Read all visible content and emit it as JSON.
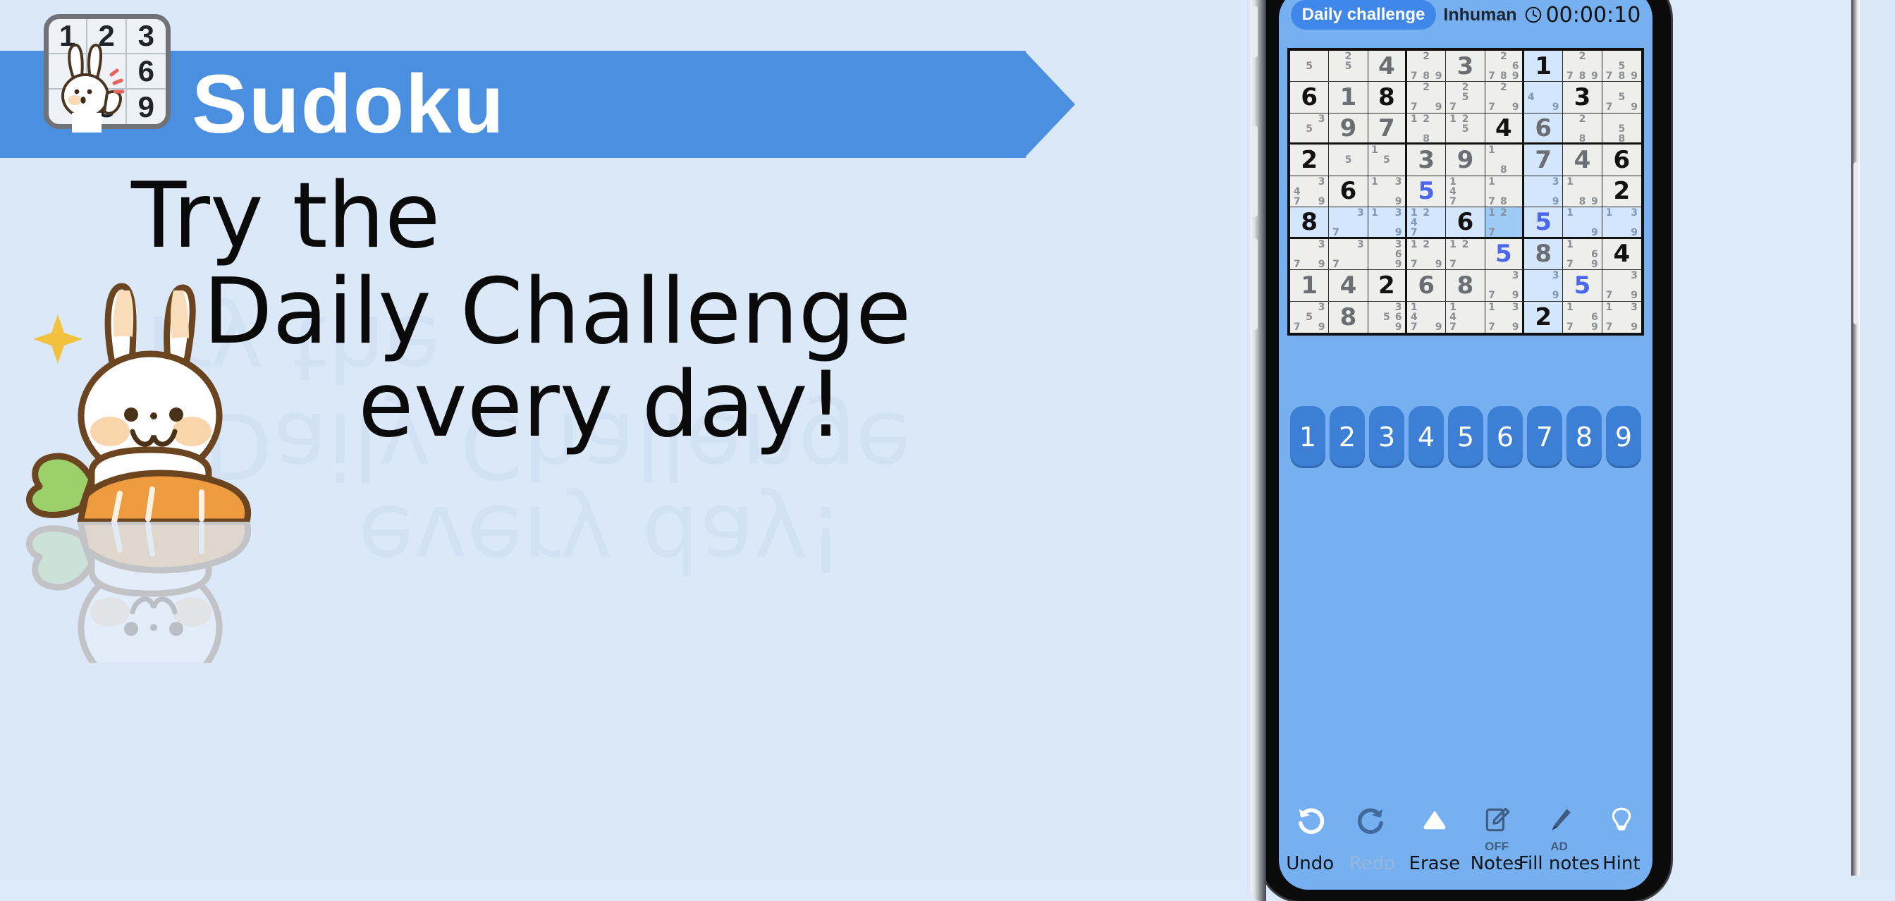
{
  "promo": {
    "banner_title": "Sudoku",
    "headline_lines": [
      "Try the",
      "Daily Challenge",
      "every day!"
    ],
    "logo_tile_digits": [
      "1",
      "2",
      "3",
      "",
      "",
      "6",
      "",
      "8",
      "9"
    ],
    "accent_blue": "#4a8fe0",
    "background": "#dbe8f8"
  },
  "phone": {
    "top_bar": {
      "daily_badge": "Daily challenge",
      "difficulty": "Inhuman",
      "clock_icon": "clock-icon",
      "timer": "00:00:10"
    },
    "numpad": [
      "1",
      "2",
      "3",
      "4",
      "5",
      "6",
      "7",
      "8",
      "9"
    ],
    "toolbar": [
      {
        "icon": "undo-icon",
        "label": "Undo",
        "badge": "",
        "disabled": false
      },
      {
        "icon": "redo-icon",
        "label": "Redo",
        "badge": "",
        "disabled": true
      },
      {
        "icon": "eraser-icon",
        "label": "Erase",
        "badge": "",
        "disabled": false
      },
      {
        "icon": "notes-icon",
        "label": "Notes",
        "badge": "OFF",
        "disabled": false
      },
      {
        "icon": "fill-notes-icon",
        "label": "Fill notes",
        "badge": "AD",
        "disabled": false
      },
      {
        "icon": "hint-bulb-icon",
        "label": "Hint",
        "badge": "",
        "disabled": false
      }
    ],
    "board": {
      "selected_cell": [
        5,
        5
      ],
      "highlighted_rows": [
        5
      ],
      "highlighted_cols": [
        6
      ],
      "colors": {
        "given": "#111111",
        "solved": "#6b6f73",
        "user_entry": "#4b67f0",
        "note": "#8b8f93",
        "cell_bg": "#eeeeec",
        "highlight_bg": "#d3e6fb",
        "selected_bg": "#9ecbf5"
      },
      "cells": [
        [
          {
            "v": "",
            "k": "",
            "n": [
              0,
              0,
              0,
              0,
              5,
              0,
              0,
              0,
              0
            ]
          },
          {
            "v": "",
            "k": "",
            "n": [
              0,
              2,
              0,
              0,
              5,
              0,
              0,
              0,
              0
            ]
          },
          {
            "v": "4",
            "k": "solved",
            "n": []
          },
          {
            "v": "",
            "k": "",
            "n": [
              0,
              2,
              0,
              0,
              0,
              0,
              7,
              8,
              9
            ]
          },
          {
            "v": "3",
            "k": "solved",
            "n": []
          },
          {
            "v": "",
            "k": "",
            "n": [
              0,
              2,
              0,
              0,
              0,
              6,
              7,
              8,
              9
            ]
          },
          {
            "v": "1",
            "k": "given",
            "n": []
          },
          {
            "v": "",
            "k": "",
            "n": [
              0,
              2,
              0,
              0,
              0,
              0,
              7,
              8,
              9
            ]
          },
          {
            "v": "",
            "k": "",
            "n": [
              0,
              0,
              0,
              0,
              5,
              0,
              7,
              8,
              9
            ]
          }
        ],
        [
          {
            "v": "6",
            "k": "given",
            "n": []
          },
          {
            "v": "1",
            "k": "solved",
            "n": []
          },
          {
            "v": "8",
            "k": "given",
            "n": []
          },
          {
            "v": "",
            "k": "",
            "n": [
              0,
              2,
              0,
              0,
              0,
              0,
              7,
              0,
              9
            ]
          },
          {
            "v": "",
            "k": "",
            "n": [
              0,
              2,
              0,
              0,
              5,
              0,
              7,
              0,
              0
            ]
          },
          {
            "v": "",
            "k": "",
            "n": [
              0,
              2,
              0,
              0,
              0,
              0,
              7,
              0,
              9
            ]
          },
          {
            "v": "",
            "k": "",
            "n": [
              0,
              0,
              0,
              4,
              0,
              0,
              0,
              0,
              9
            ]
          },
          {
            "v": "3",
            "k": "given",
            "n": []
          },
          {
            "v": "",
            "k": "",
            "n": [
              0,
              0,
              0,
              0,
              5,
              0,
              7,
              0,
              9
            ]
          }
        ],
        [
          {
            "v": "",
            "k": "",
            "n": [
              0,
              0,
              3,
              0,
              5,
              0,
              0,
              0,
              0
            ]
          },
          {
            "v": "9",
            "k": "solved",
            "n": []
          },
          {
            "v": "7",
            "k": "solved",
            "n": []
          },
          {
            "v": "",
            "k": "",
            "n": [
              1,
              2,
              0,
              0,
              0,
              0,
              0,
              8,
              0
            ]
          },
          {
            "v": "",
            "k": "",
            "n": [
              1,
              2,
              0,
              0,
              5,
              0,
              0,
              0,
              0
            ]
          },
          {
            "v": "4",
            "k": "given",
            "n": []
          },
          {
            "v": "6",
            "k": "solved",
            "n": []
          },
          {
            "v": "",
            "k": "",
            "n": [
              0,
              2,
              0,
              0,
              0,
              0,
              0,
              8,
              0
            ]
          },
          {
            "v": "",
            "k": "",
            "n": [
              0,
              0,
              0,
              0,
              5,
              0,
              0,
              8,
              0
            ]
          }
        ],
        [
          {
            "v": "2",
            "k": "given",
            "n": []
          },
          {
            "v": "",
            "k": "",
            "n": [
              0,
              0,
              0,
              0,
              5,
              0,
              0,
              0,
              0
            ]
          },
          {
            "v": "",
            "k": "",
            "n": [
              1,
              0,
              0,
              0,
              5,
              0,
              0,
              0,
              0
            ]
          },
          {
            "v": "3",
            "k": "solved",
            "n": []
          },
          {
            "v": "9",
            "k": "solved",
            "n": []
          },
          {
            "v": "",
            "k": "",
            "n": [
              1,
              0,
              0,
              0,
              0,
              0,
              0,
              8,
              0
            ]
          },
          {
            "v": "7",
            "k": "solved",
            "n": []
          },
          {
            "v": "4",
            "k": "solved",
            "n": []
          },
          {
            "v": "6",
            "k": "given",
            "n": []
          }
        ],
        [
          {
            "v": "",
            "k": "",
            "n": [
              0,
              0,
              3,
              4,
              0,
              0,
              7,
              0,
              9
            ]
          },
          {
            "v": "6",
            "k": "given",
            "n": []
          },
          {
            "v": "",
            "k": "",
            "n": [
              1,
              0,
              3,
              0,
              0,
              0,
              0,
              0,
              9
            ]
          },
          {
            "v": "5",
            "k": "user",
            "n": []
          },
          {
            "v": "",
            "k": "",
            "n": [
              1,
              0,
              0,
              4,
              0,
              0,
              7,
              0,
              0
            ]
          },
          {
            "v": "",
            "k": "",
            "n": [
              1,
              0,
              0,
              0,
              0,
              0,
              7,
              8,
              0
            ]
          },
          {
            "v": "",
            "k": "",
            "n": [
              0,
              0,
              3,
              0,
              0,
              0,
              0,
              0,
              9
            ]
          },
          {
            "v": "",
            "k": "",
            "n": [
              1,
              0,
              0,
              0,
              0,
              0,
              0,
              8,
              9
            ]
          },
          {
            "v": "2",
            "k": "given",
            "n": []
          }
        ],
        [
          {
            "v": "8",
            "k": "given",
            "n": []
          },
          {
            "v": "",
            "k": "",
            "n": [
              0,
              0,
              3,
              0,
              0,
              0,
              7,
              0,
              0
            ]
          },
          {
            "v": "",
            "k": "",
            "n": [
              1,
              0,
              3,
              0,
              0,
              0,
              0,
              0,
              9
            ]
          },
          {
            "v": "",
            "k": "",
            "n": [
              1,
              2,
              0,
              4,
              0,
              0,
              7,
              0,
              0
            ]
          },
          {
            "v": "6",
            "k": "given",
            "n": []
          },
          {
            "v": "",
            "k": "",
            "n": [
              1,
              2,
              0,
              0,
              0,
              0,
              7,
              0,
              0
            ]
          },
          {
            "v": "5",
            "k": "user",
            "n": []
          },
          {
            "v": "",
            "k": "",
            "n": [
              1,
              0,
              0,
              0,
              0,
              0,
              0,
              0,
              9
            ]
          },
          {
            "v": "",
            "k": "",
            "n": [
              1,
              0,
              3,
              0,
              0,
              0,
              0,
              0,
              9
            ]
          }
        ],
        [
          {
            "v": "",
            "k": "",
            "n": [
              0,
              0,
              3,
              0,
              0,
              0,
              7,
              0,
              9
            ]
          },
          {
            "v": "",
            "k": "",
            "n": [
              0,
              0,
              3,
              0,
              0,
              0,
              7,
              0,
              0
            ]
          },
          {
            "v": "",
            "k": "",
            "n": [
              0,
              0,
              3,
              0,
              0,
              6,
              0,
              0,
              9
            ]
          },
          {
            "v": "",
            "k": "",
            "n": [
              1,
              2,
              0,
              0,
              0,
              0,
              7,
              0,
              9
            ]
          },
          {
            "v": "",
            "k": "",
            "n": [
              1,
              2,
              0,
              0,
              0,
              0,
              7,
              0,
              0
            ]
          },
          {
            "v": "5",
            "k": "user",
            "n": []
          },
          {
            "v": "8",
            "k": "solved",
            "n": []
          },
          {
            "v": "",
            "k": "",
            "n": [
              1,
              0,
              0,
              0,
              0,
              6,
              7,
              0,
              9
            ]
          },
          {
            "v": "4",
            "k": "given",
            "n": []
          }
        ],
        [
          {
            "v": "1",
            "k": "solved",
            "n": []
          },
          {
            "v": "4",
            "k": "solved",
            "n": []
          },
          {
            "v": "2",
            "k": "given",
            "n": []
          },
          {
            "v": "6",
            "k": "solved",
            "n": []
          },
          {
            "v": "8",
            "k": "solved",
            "n": []
          },
          {
            "v": "",
            "k": "",
            "n": [
              0,
              0,
              3,
              0,
              0,
              0,
              7,
              0,
              9
            ]
          },
          {
            "v": "",
            "k": "",
            "n": [
              0,
              0,
              3,
              0,
              0,
              0,
              0,
              0,
              9
            ]
          },
          {
            "v": "5",
            "k": "user",
            "n": []
          },
          {
            "v": "",
            "k": "",
            "n": [
              0,
              0,
              3,
              0,
              0,
              0,
              7,
              0,
              9
            ]
          }
        ],
        [
          {
            "v": "",
            "k": "",
            "n": [
              0,
              0,
              3,
              0,
              5,
              0,
              7,
              0,
              9
            ]
          },
          {
            "v": "8",
            "k": "solved",
            "n": []
          },
          {
            "v": "",
            "k": "",
            "n": [
              0,
              0,
              3,
              0,
              5,
              6,
              0,
              0,
              9
            ]
          },
          {
            "v": "",
            "k": "",
            "n": [
              1,
              0,
              0,
              4,
              0,
              0,
              7,
              0,
              9
            ]
          },
          {
            "v": "",
            "k": "",
            "n": [
              1,
              0,
              0,
              4,
              0,
              0,
              7,
              0,
              0
            ]
          },
          {
            "v": "",
            "k": "",
            "n": [
              1,
              0,
              3,
              0,
              0,
              0,
              7,
              0,
              9
            ]
          },
          {
            "v": "2",
            "k": "given",
            "n": []
          },
          {
            "v": "",
            "k": "",
            "n": [
              1,
              0,
              0,
              0,
              0,
              6,
              7,
              0,
              9
            ]
          },
          {
            "v": "",
            "k": "",
            "n": [
              1,
              0,
              3,
              0,
              0,
              0,
              7,
              0,
              9
            ]
          }
        ]
      ]
    }
  }
}
